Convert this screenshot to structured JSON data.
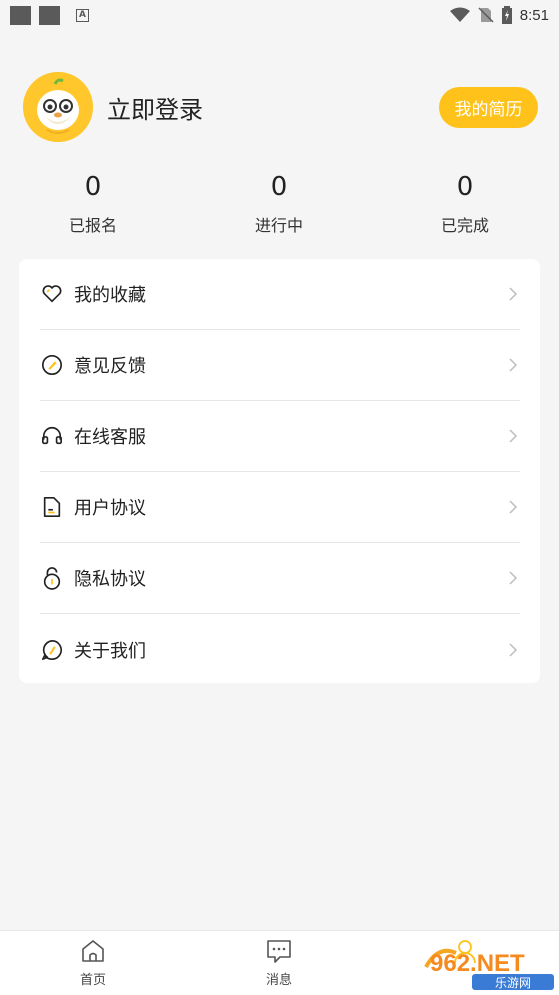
{
  "status_bar": {
    "time": "8:51"
  },
  "profile": {
    "login_text": "立即登录",
    "resume_button": "我的简历"
  },
  "stats": [
    {
      "value": "0",
      "label": "已报名"
    },
    {
      "value": "0",
      "label": "进行中"
    },
    {
      "value": "0",
      "label": "已完成"
    }
  ],
  "menu": [
    {
      "label": "我的收藏",
      "icon": "heart-icon"
    },
    {
      "label": "意见反馈",
      "icon": "pencil-circle-icon"
    },
    {
      "label": "在线客服",
      "icon": "headset-icon"
    },
    {
      "label": "用户协议",
      "icon": "document-icon"
    },
    {
      "label": "隐私协议",
      "icon": "lock-icon"
    },
    {
      "label": "关于我们",
      "icon": "info-bubble-icon"
    }
  ],
  "bottom_nav": [
    {
      "label": "首页",
      "icon": "home-icon"
    },
    {
      "label": "消息",
      "icon": "message-icon"
    },
    {
      "label": "",
      "icon": "profile-icon"
    }
  ],
  "watermark": {
    "text": "962.NET",
    "subtext": "乐游网"
  },
  "colors": {
    "accent": "#ffc21a",
    "avatar_bg": "#ffc72b"
  }
}
